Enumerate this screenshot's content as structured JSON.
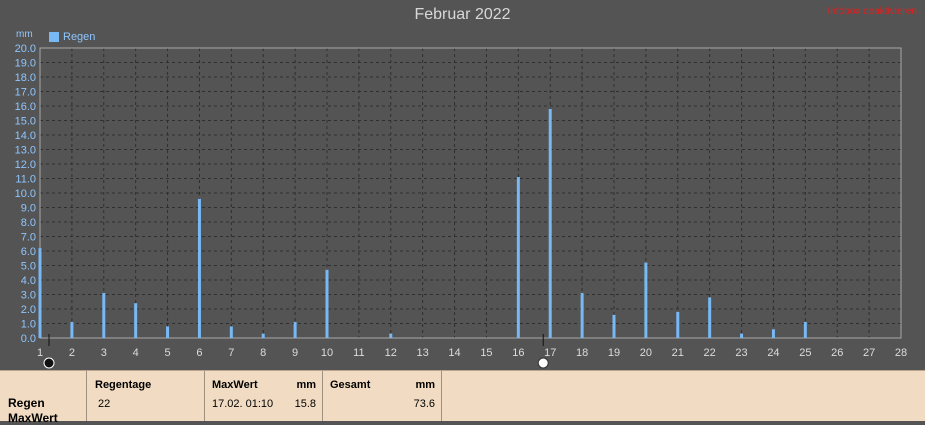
{
  "chart_data": {
    "type": "bar",
    "title": "Februar 2022",
    "ylabel": "mm",
    "ylim": [
      0,
      20
    ],
    "yticks": [
      "0.0",
      "1.0",
      "2.0",
      "3.0",
      "4.0",
      "5.0",
      "6.0",
      "7.0",
      "8.0",
      "9.0",
      "10.0",
      "11.0",
      "12.0",
      "13.0",
      "14.0",
      "15.0",
      "16.0",
      "17.0",
      "18.0",
      "19.0",
      "20.0"
    ],
    "xticks": [
      1,
      2,
      3,
      4,
      5,
      6,
      7,
      8,
      9,
      10,
      11,
      12,
      13,
      14,
      15,
      16,
      17,
      18,
      19,
      20,
      21,
      22,
      23,
      24,
      25,
      26,
      27,
      28
    ],
    "xlim": [
      1,
      28
    ],
    "series": [
      {
        "name": "Regen",
        "points": [
          {
            "x": 1,
            "y": 6.2
          },
          {
            "x": 2,
            "y": 1.1
          },
          {
            "x": 3,
            "y": 3.1
          },
          {
            "x": 4,
            "y": 2.4
          },
          {
            "x": 5,
            "y": 0.8
          },
          {
            "x": 6,
            "y": 9.6
          },
          {
            "x": 7,
            "y": 0.8
          },
          {
            "x": 8,
            "y": 0.3
          },
          {
            "x": 9,
            "y": 1.1
          },
          {
            "x": 10,
            "y": 4.7
          },
          {
            "x": 12,
            "y": 0.3
          },
          {
            "x": 16,
            "y": 11.1
          },
          {
            "x": 17,
            "y": 15.8
          },
          {
            "x": 18,
            "y": 3.1
          },
          {
            "x": 19,
            "y": 1.6
          },
          {
            "x": 20,
            "y": 5.2
          },
          {
            "x": 21,
            "y": 1.8
          },
          {
            "x": 22,
            "y": 2.8
          },
          {
            "x": 23,
            "y": 0.3
          },
          {
            "x": 24,
            "y": 0.6
          },
          {
            "x": 25,
            "y": 1.1
          }
        ]
      }
    ],
    "grid": true,
    "legend_position": "top-left"
  },
  "colors": {
    "bar": "#78b8f4",
    "grid": "#2f2f2f",
    "axis": "#a9a9a9",
    "ytick_text": "#8fc6ff",
    "xtick_text": "#dcdcdc"
  },
  "hint_text": "Infobox deaktivieren",
  "panel": {
    "row1_label": "Regen",
    "row2_label": "MaxWert",
    "regentage_header": "Regentage",
    "regentage_value": "22",
    "maxwert_header": "MaxWert",
    "maxwert_unit": "mm",
    "maxwert_date": "17.02.  01:10",
    "maxwert_value": "15.8",
    "gesamt_header": "Gesamt",
    "gesamt_unit": "mm",
    "gesamt_value": "73.6"
  }
}
